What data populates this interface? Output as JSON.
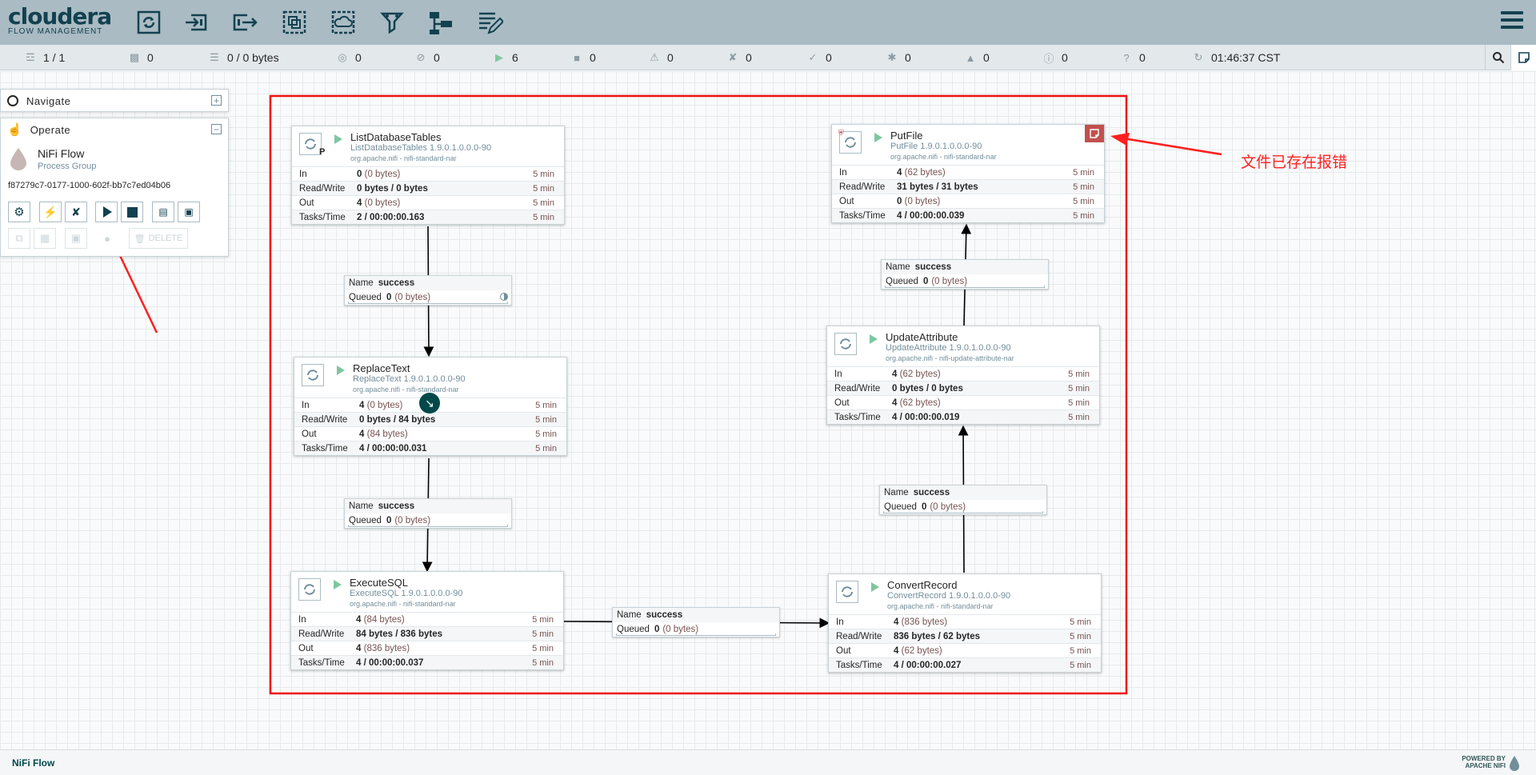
{
  "header": {
    "logo_line1": "cloudera",
    "logo_line2": "FLOW MANAGEMENT",
    "tools": [
      "processor-icon",
      "input-port-icon",
      "output-port-icon",
      "process-group-icon",
      "remote-process-group-icon",
      "funnel-icon",
      "template-icon",
      "label-icon"
    ]
  },
  "status": {
    "cluster": "1 / 1",
    "threads": "0",
    "queued": "0 / 0 bytes",
    "transmitting": "0",
    "not_transmitting": "0",
    "running": "6",
    "stopped": "0",
    "invalid": "0",
    "disabled": "0",
    "up_to_date": "0",
    "locally_modified": "0",
    "stale": "0",
    "errors": "0",
    "sync_failure": "0",
    "refresh_time": "01:46:37 CST"
  },
  "navigate": {
    "title": "Navigate"
  },
  "operate": {
    "title": "Operate",
    "name": "NiFi Flow",
    "type": "Process Group",
    "id": "f87279c7-0177-1000-602f-bb7c7ed04b06",
    "delete_label": "DELETE"
  },
  "processors": {
    "list": {
      "name": "ListDatabaseTables",
      "type": "ListDatabaseTables 1.9.0.1.0.0.0-90",
      "bundle": "org.apache.nifi - nifi-standard-nar",
      "in_count": "0",
      "in_size": "(0 bytes)",
      "rw": "0 bytes / 0 bytes",
      "out_count": "4",
      "out_size": "(0 bytes)",
      "tasks": "2 / 00:00:00.163",
      "time": "5 min"
    },
    "replace": {
      "name": "ReplaceText",
      "type": "ReplaceText 1.9.0.1.0.0.0-90",
      "bundle": "org.apache.nifi - nifi-standard-nar",
      "in_count": "4",
      "in_size": "(0 bytes)",
      "rw": "0 bytes / 84 bytes",
      "out_count": "4",
      "out_size": "(84 bytes)",
      "tasks": "4 / 00:00:00.031",
      "time": "5 min"
    },
    "execute": {
      "name": "ExecuteSQL",
      "type": "ExecuteSQL 1.9.0.1.0.0.0-90",
      "bundle": "org.apache.nifi - nifi-standard-nar",
      "in_count": "4",
      "in_size": "(84 bytes)",
      "rw": "84 bytes / 836 bytes",
      "out_count": "4",
      "out_size": "(836 bytes)",
      "tasks": "4 / 00:00:00.037",
      "time": "5 min"
    },
    "convert": {
      "name": "ConvertRecord",
      "type": "ConvertRecord 1.9.0.1.0.0.0-90",
      "bundle": "org.apache.nifi - nifi-standard-nar",
      "in_count": "4",
      "in_size": "(836 bytes)",
      "rw": "836 bytes / 62 bytes",
      "out_count": "4",
      "out_size": "(62 bytes)",
      "tasks": "4 / 00:00:00.027",
      "time": "5 min"
    },
    "update": {
      "name": "UpdateAttribute",
      "type": "UpdateAttribute 1.9.0.1.0.0.0-90",
      "bundle": "org.apache.nifi - nifi-update-attribute-nar",
      "in_count": "4",
      "in_size": "(62 bytes)",
      "rw": "0 bytes / 0 bytes",
      "out_count": "4",
      "out_size": "(62 bytes)",
      "tasks": "4 / 00:00:00.019",
      "time": "5 min"
    },
    "putfile": {
      "name": "PutFile",
      "type": "PutFile 1.9.0.1.0.0.0-90",
      "bundle": "org.apache.nifi - nifi-standard-nar",
      "in_count": "4",
      "in_size": "(62 bytes)",
      "rw": "31 bytes / 31 bytes",
      "out_count": "0",
      "out_size": "(0 bytes)",
      "tasks": "4 / 00:00:00.039",
      "time": "5 min"
    }
  },
  "labels": {
    "in": "In",
    "rw": "Read/Write",
    "out": "Out",
    "tasks": "Tasks/Time",
    "name": "Name",
    "queued": "Queued",
    "p_badge": "P"
  },
  "connection": {
    "relationship": "success",
    "queued_count": "0",
    "queued_size": "(0 bytes)"
  },
  "annotation": {
    "text": "文件已存在报错",
    "color": "#ff1f1f"
  },
  "footer": {
    "breadcrumb": "NiFi Flow",
    "powered_line1": "POWERED BY",
    "powered_line2": "APACHE NIFI"
  },
  "colors": {
    "header_bg": "#aabbc3",
    "brand": "#134150",
    "running": "#7dc7a0",
    "bulletin": "#c0504d"
  }
}
